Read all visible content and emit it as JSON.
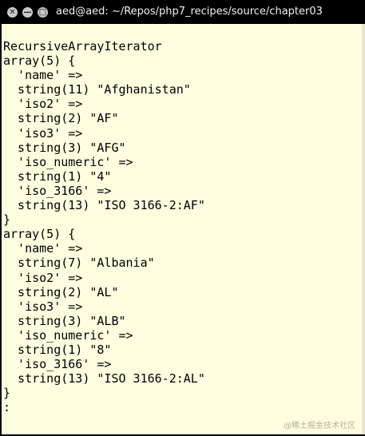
{
  "window": {
    "title": "aed@aed: ~/Repos/php7_recipes/source/chapter03",
    "buttons": [
      {
        "name": "close-button",
        "glyph": "✕"
      },
      {
        "name": "minimize-button",
        "glyph": "—"
      },
      {
        "name": "maximize-button",
        "glyph": "□"
      }
    ]
  },
  "terminal": {
    "background": "#fffde0",
    "lines": [
      "RecursiveArrayIterator",
      "array(5) {",
      "  'name' =>",
      "  string(11) \"Afghanistan\"",
      "  'iso2' =>",
      "  string(2) \"AF\"",
      "  'iso3' =>",
      "  string(3) \"AFG\"",
      "  'iso_numeric' =>",
      "  string(1) \"4\"",
      "  'iso_3166' =>",
      "  string(13) \"ISO 3166-2:AF\"",
      "}",
      "array(5) {",
      "  'name' =>",
      "  string(7) \"Albania\"",
      "  'iso2' =>",
      "  string(2) \"AL\"",
      "  'iso3' =>",
      "  string(3) \"ALB\"",
      "  'iso_numeric' =>",
      "  string(1) \"8\"",
      "  'iso_3166' =>",
      "  string(13) \"ISO 3166-2:AL\"",
      "}",
      ":"
    ],
    "watermark": "@稀土掘金技术社区"
  }
}
